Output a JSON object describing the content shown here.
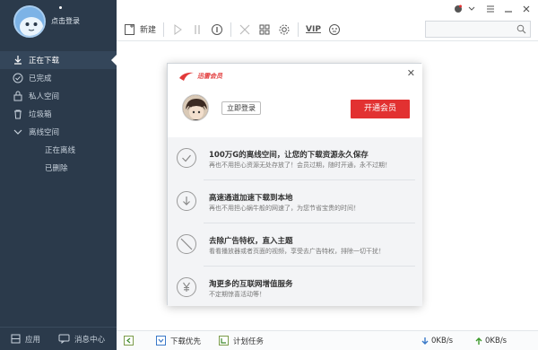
{
  "user": {
    "login_text": "点击登录"
  },
  "nav": {
    "items": [
      {
        "label": "正在下载",
        "icon": "download-icon",
        "active": true
      },
      {
        "label": "已完成",
        "icon": "check-circle-icon"
      },
      {
        "label": "私人空间",
        "icon": "private-space-icon"
      },
      {
        "label": "垃圾箱",
        "icon": "trash-icon"
      },
      {
        "label": "离线空间",
        "icon": "chevron-down-icon"
      },
      {
        "label": "正在离线",
        "sub": true
      },
      {
        "label": "已删除",
        "sub": true
      }
    ]
  },
  "sidebar_bottom": {
    "apps_label": "应用",
    "messages_label": "消息中心"
  },
  "toolbar": {
    "new_label": "新建",
    "vip_label": "VIP"
  },
  "statusbar": {
    "download_priority": "下载优先",
    "scheduled_tasks": "计划任务",
    "down_speed": "0KB/s",
    "up_speed": "0KB/s"
  },
  "dialog": {
    "brand": "迅雷会员",
    "login_now": "立即登录",
    "open_vip": "开通会员",
    "features": [
      {
        "title": "100万G的离线空间，让您的下载资源永久保存",
        "sub": "再也不用担心资源无处存放了！会员过期，随时开通，永不过期！",
        "icon": "check-circle-icon"
      },
      {
        "title": "高速通道加速下载到本地",
        "sub": "再也不用担心蜗牛般的网速了，为您节省宝贵的时间！",
        "icon": "download-circle-icon"
      },
      {
        "title": "去除广告特权，直入主题",
        "sub": "看看播放器或者页面的视频，享受去广告特权，排除一切干扰！",
        "icon": "no-ads-icon"
      },
      {
        "title": "淘更多的互联网增值服务",
        "sub": "不定期惊喜活动等！",
        "icon": "yen-icon"
      }
    ]
  },
  "colors": {
    "sidebar": "#2b3a4b",
    "accent_red": "#e23131",
    "brand_red": "#e23a3a"
  }
}
